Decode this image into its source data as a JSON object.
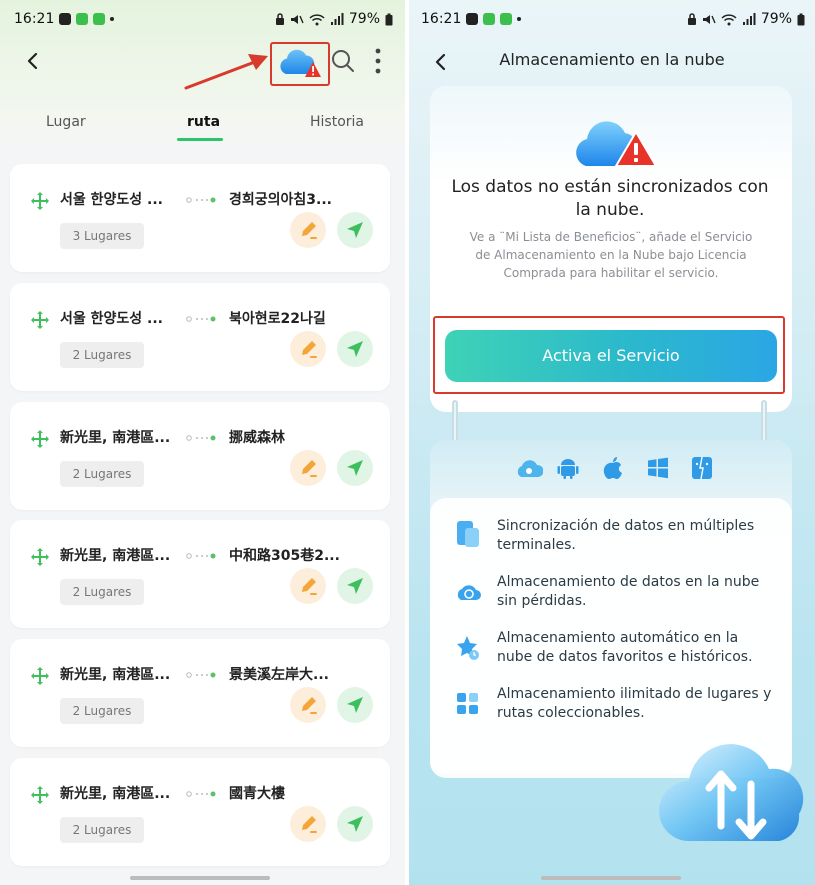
{
  "left": {
    "status": {
      "time": "16:21",
      "battery": "79%"
    },
    "tabs": [
      "Lugar",
      "ruta",
      "Historia"
    ],
    "routes": [
      {
        "from": "서울 한양도성 ...",
        "to": "경희궁의아침3...",
        "places": "3 Lugares"
      },
      {
        "from": "서울 한양도성 ...",
        "to": "북아현로22나길",
        "places": "2 Lugares"
      },
      {
        "from": "新光里, 南港區...",
        "to": "挪威森林",
        "places": "2 Lugares"
      },
      {
        "from": "新光里, 南港區...",
        "to": "中和路305巷2...",
        "places": "2 Lugares"
      },
      {
        "from": "新光里, 南港區...",
        "to": "景美溪左岸大...",
        "places": "2 Lugares"
      },
      {
        "from": "新光里, 南港區...",
        "to": "國青大樓",
        "places": "2 Lugares"
      }
    ]
  },
  "right": {
    "status": {
      "time": "16:21",
      "battery": "79%"
    },
    "title": "Almacenamiento en la nube",
    "heading": "Los datos no están sincronizados con la nube.",
    "description": "Ve a ¨Mi Lista de Beneficios¨, añade el Servicio de Almacenamiento en la Nube bajo Licencia Comprada para habilitar el servicio.",
    "cta": "Activa el Servicio",
    "platform_icons": [
      "cloud-icon",
      "android-icon",
      "apple-icon",
      "windows-icon",
      "finder-icon"
    ],
    "features": [
      "Sincronización de datos en múltiples terminales.",
      "Almacenamiento de datos en la nube sin pérdidas.",
      "Almacenamiento automático en la nube de datos favoritos e históricos.",
      "Almacenamiento ilimitado de lugares y rutas coleccionables."
    ]
  },
  "colors": {
    "accent_green": "#2bc46e",
    "highlight_red": "#d83a2c",
    "cta_start": "#3fd2b6",
    "cta_end": "#2ba6e5"
  }
}
